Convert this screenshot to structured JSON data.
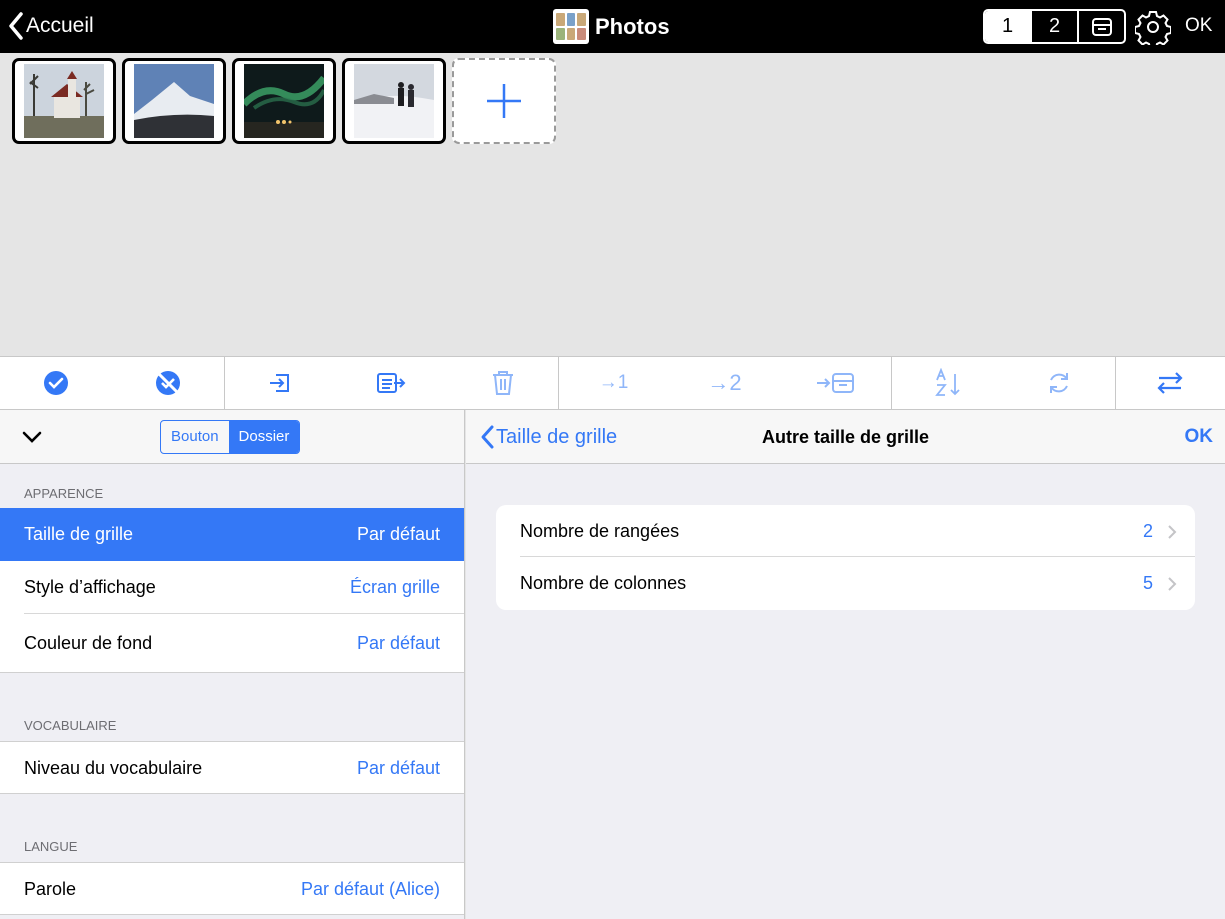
{
  "topbar": {
    "back_label": "Accueil",
    "title": "Photos",
    "pages": [
      "1",
      "2"
    ],
    "ok_label": "OK"
  },
  "photos": [
    {
      "name": "church-photo",
      "sky": "#c9d2dc",
      "ground": "#7c7a66"
    },
    {
      "name": "mountain-photo",
      "sky": "#5d7fb3",
      "ground": "#2d2f33"
    },
    {
      "name": "aurora-photo",
      "sky": "#0f1c1c",
      "ground": "#2b2b22"
    },
    {
      "name": "snow-hikers-photo",
      "sky": "#cfd5dd",
      "ground": "#eef0f3"
    }
  ],
  "toolbar": {
    "page1_label": "→1",
    "page2_label": "→2"
  },
  "left": {
    "seg_bouton": "Bouton",
    "seg_dossier": "Dossier",
    "section_apparence": "APPARENCE",
    "section_vocabulaire": "VOCABULAIRE",
    "section_langue": "LANGUE",
    "rows": {
      "taille": {
        "label": "Taille de grille",
        "value": "Par défaut"
      },
      "style": {
        "label": "Style d’affichage",
        "value": "Écran grille"
      },
      "couleur": {
        "label": "Couleur de fond",
        "value": "Par défaut"
      },
      "niveau": {
        "label": "Niveau du vocabulaire",
        "value": "Par défaut"
      },
      "parole": {
        "label": "Parole",
        "value": "Par défaut (Alice)"
      }
    }
  },
  "right": {
    "back_label": "Taille de grille",
    "title": "Autre taille de grille",
    "ok_label": "OK",
    "rows": {
      "rangees": {
        "label": "Nombre de rangées",
        "value": "2"
      },
      "colonnes": {
        "label": "Nombre de colonnes",
        "value": "5"
      }
    }
  },
  "colors": {
    "accent": "#3478f6",
    "topbar": "#000000"
  }
}
